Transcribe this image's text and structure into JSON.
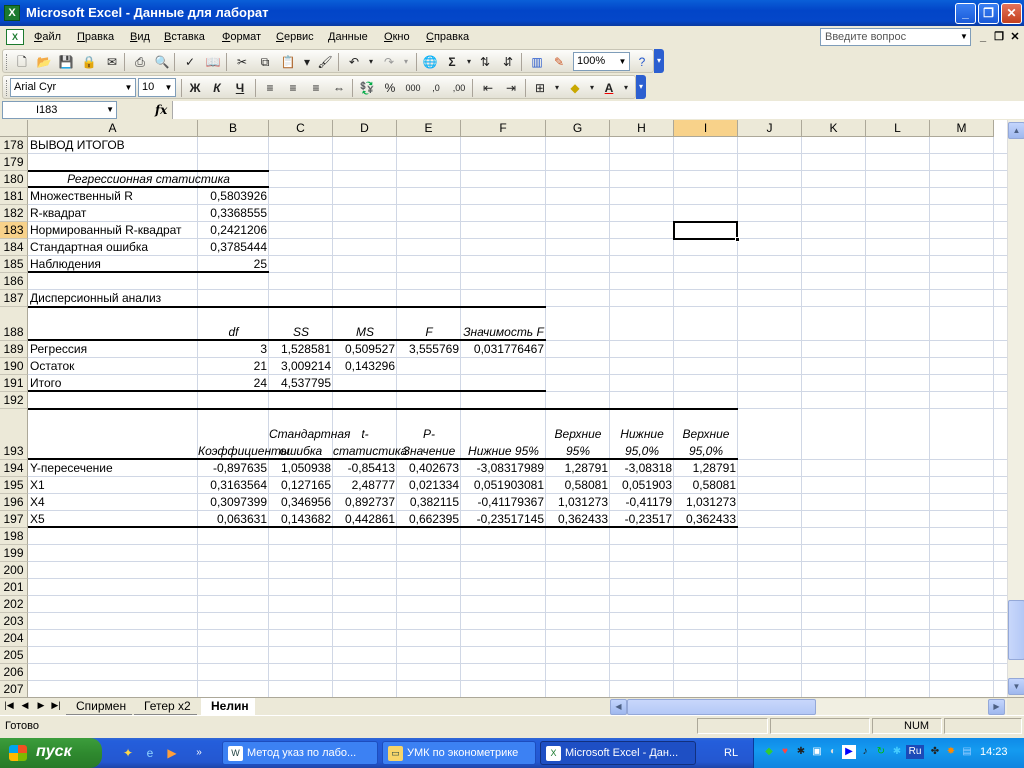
{
  "window": {
    "title": "Microsoft Excel - Данные для лаборат",
    "app_icon": "excel-icon",
    "buttons": {
      "minimize": "_",
      "maximize": "❐",
      "close": "✕"
    }
  },
  "menu": {
    "items": [
      "Файл",
      "Правка",
      "Вид",
      "Вставка",
      "Формат",
      "Сервис",
      "Данные",
      "Окно",
      "Справка"
    ],
    "ask_placeholder": "Введите вопрос"
  },
  "toolbar": {
    "zoom": "100%",
    "font_name": "Arial Cyr",
    "font_size": "10",
    "bold_label": "Ж",
    "italic_label": "К",
    "underline_label": "Ч",
    "sigma_label": "Σ"
  },
  "formula_bar": {
    "name_box": "I183",
    "fx_label": "fx",
    "content": ""
  },
  "columns": [
    "A",
    "B",
    "C",
    "D",
    "E",
    "F",
    "G",
    "H",
    "I",
    "J",
    "K",
    "L",
    "M"
  ],
  "selected_column": "I",
  "selected_row": "183",
  "rows": [
    "178",
    "179",
    "180",
    "181",
    "182",
    "183",
    "184",
    "185",
    "186",
    "187",
    "188",
    "189",
    "190",
    "191",
    "192",
    "193",
    "194",
    "195",
    "196",
    "197",
    "198",
    "199",
    "200",
    "201",
    "202",
    "203",
    "204",
    "205",
    "206",
    "207"
  ],
  "sheet": {
    "r178": {
      "a": "ВЫВОД ИТОГОВ"
    },
    "r180": {
      "a": "Регрессионная статистика"
    },
    "r181": {
      "a": "Множественный R",
      "b": "0,5803926"
    },
    "r182": {
      "a": "R-квадрат",
      "b": "0,3368555"
    },
    "r183": {
      "a": "Нормированный R-квадрат",
      "b": "0,2421206"
    },
    "r184": {
      "a": "Стандартная ошибка",
      "b": "0,3785444"
    },
    "r185": {
      "a": "Наблюдения",
      "b": "25"
    },
    "r187": {
      "a": "Дисперсионный анализ"
    },
    "r188": {
      "b": "df",
      "c": "SS",
      "d": "MS",
      "e": "F",
      "f": "Значимость F"
    },
    "r189": {
      "a": "Регрессия",
      "b": "3",
      "c": "1,528581",
      "d": "0,509527",
      "e": "3,555769",
      "f": "0,031776467"
    },
    "r190": {
      "a": "Остаток",
      "b": "21",
      "c": "3,009214",
      "d": "0,143296"
    },
    "r191": {
      "a": "Итого",
      "b": "24",
      "c": "4,537795"
    },
    "r193": {
      "b": "Коэффициенты",
      "c": "Стандартная ошибка",
      "d": "t-статистика",
      "e": "P-Значение",
      "f": "Нижние 95%",
      "g": "Верхние 95%",
      "h": "Нижние 95,0%",
      "i": "Верхние 95,0%"
    },
    "r194": {
      "a": "Y-пересечение",
      "b": "-0,897635",
      "c": "1,050938",
      "d": "-0,85413",
      "e": "0,402673",
      "f": "-3,08317989",
      "g": "1,28791",
      "h": "-3,08318",
      "i": "1,28791"
    },
    "r195": {
      "a": "X1",
      "b": "0,3163564",
      "c": "0,127165",
      "d": "2,48777",
      "e": "0,021334",
      "f": "0,051903081",
      "g": "0,58081",
      "h": "0,051903",
      "i": "0,58081"
    },
    "r196": {
      "a": "X4",
      "b": "0,3097399",
      "c": "0,346956",
      "d": "0,892737",
      "e": "0,382115",
      "f": "-0,41179367",
      "g": "1,031273",
      "h": "-0,41179",
      "i": "1,031273"
    },
    "r197": {
      "a": "X5",
      "b": "0,063631",
      "c": "0,143682",
      "d": "0,442861",
      "e": "0,662395",
      "f": "-0,23517145",
      "g": "0,362433",
      "h": "-0,23517",
      "i": "0,362433"
    }
  },
  "tabs": [
    "Спирмен",
    "Гетер x2",
    "Нелин"
  ],
  "active_tab": "Нелин",
  "status": {
    "text": "Готово",
    "num": "NUM"
  },
  "taskbar": {
    "start_label": "пуск",
    "buttons": [
      "Метод указ по лабо...",
      "УМК по эконометрике",
      "Microsoft Excel - Дан..."
    ],
    "lang": "RL",
    "tray_lang": "Ru",
    "clock": "14:23"
  }
}
